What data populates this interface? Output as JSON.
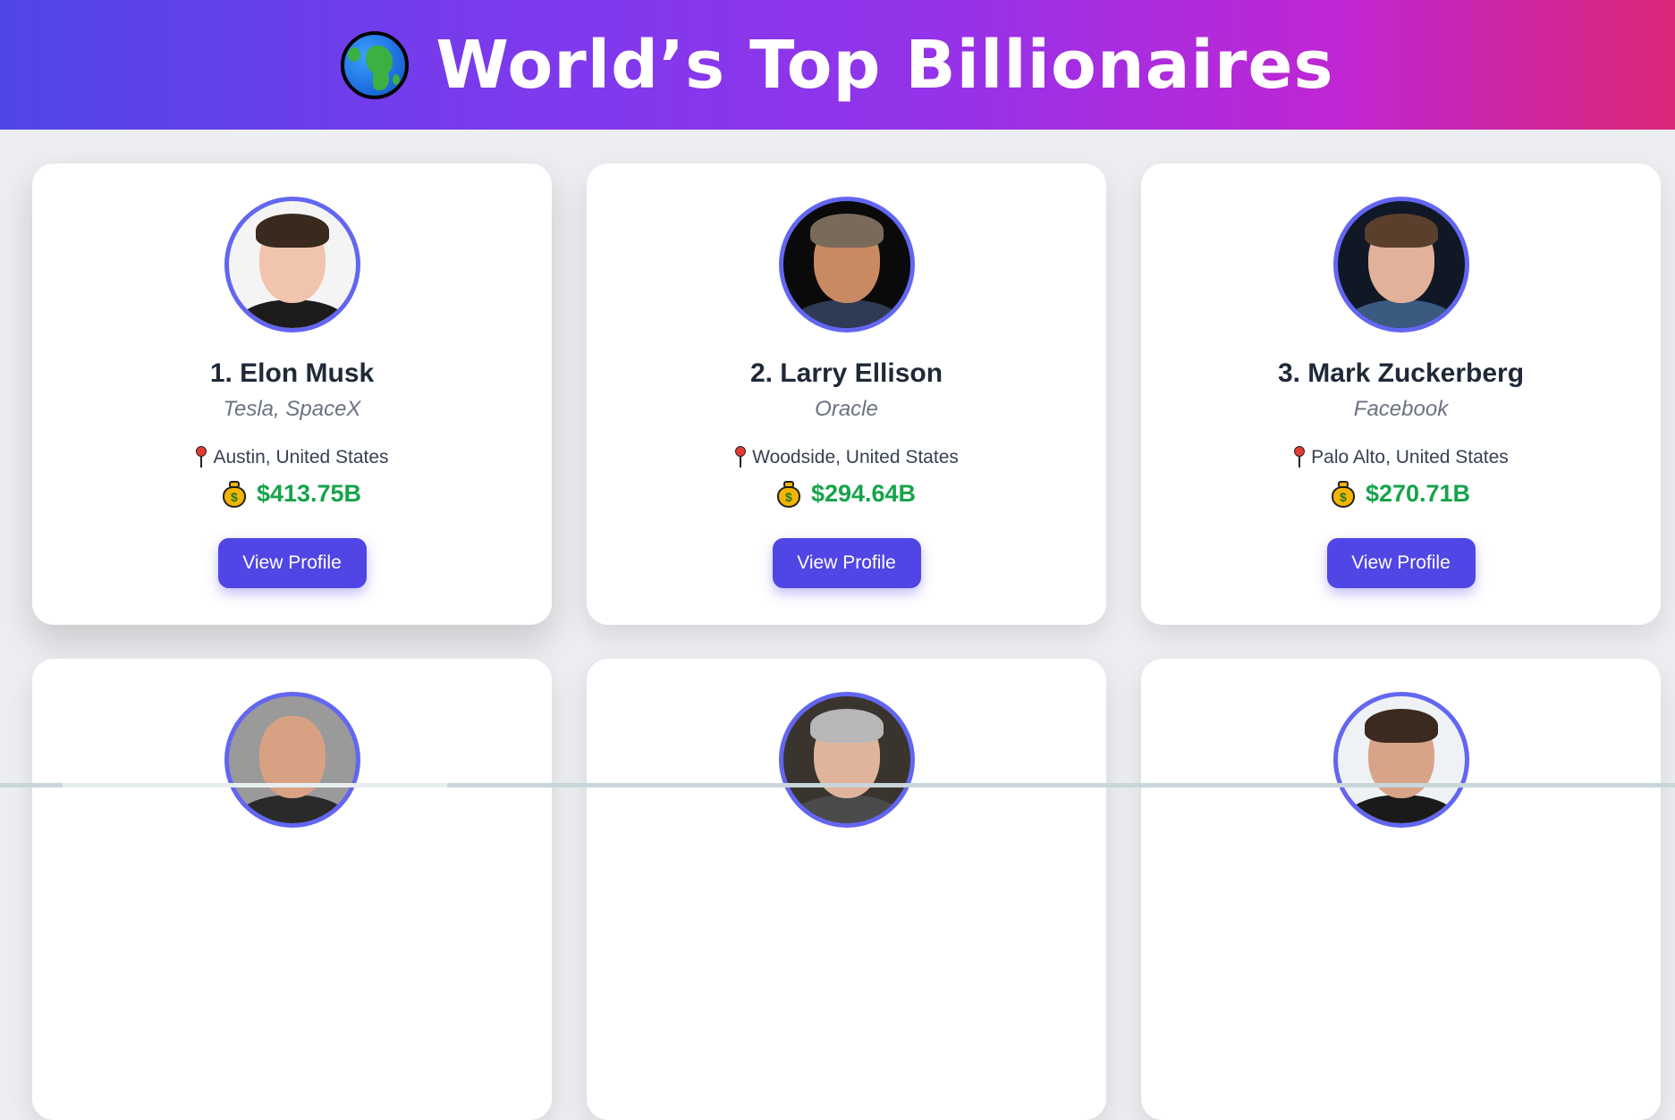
{
  "header": {
    "title": "World’s Top Billionaires",
    "icon": "globe-africa-icon"
  },
  "colors": {
    "accent": "#4f46e5",
    "avatar_ring": "#6366f1",
    "worth": "#16a34a"
  },
  "cards": [
    {
      "name": "1. Elon Musk",
      "company": "Tesla, SpaceX",
      "location": "Austin, United States",
      "worth": "$413.75B",
      "button": "View Profile",
      "avatar_icon": "elon-musk-photo"
    },
    {
      "name": "2. Larry Ellison",
      "company": "Oracle",
      "location": "Woodside, United States",
      "worth": "$294.64B",
      "button": "View Profile",
      "avatar_icon": "larry-ellison-photo"
    },
    {
      "name": "3. Mark Zuckerberg",
      "company": "Facebook",
      "location": "Palo Alto, United States",
      "worth": "$270.71B",
      "button": "View Profile",
      "avatar_icon": "mark-zuckerberg-photo"
    },
    {
      "avatar_icon": "jeff-bezos-photo"
    },
    {
      "avatar_icon": "larry-page-photo"
    },
    {
      "avatar_icon": "sergey-brin-photo"
    }
  ]
}
